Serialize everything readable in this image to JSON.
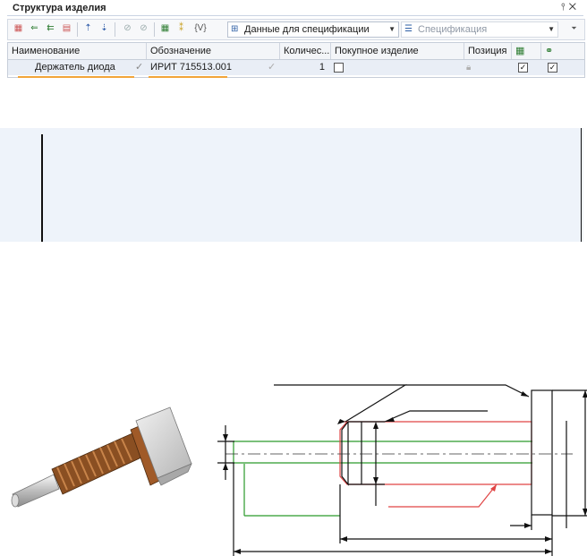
{
  "panel": {
    "title": "Структура изделия",
    "pin_icon": "pin-icon",
    "close_icon": "close-icon",
    "toolbar": {
      "spec_data_combo": "Данные для спецификации",
      "spec_combo": "Спецификация",
      "variables_label": "{V}"
    },
    "columns": [
      "Наименование",
      "Обозначение",
      "Количес...",
      "Покупное изделие",
      "Позиция"
    ],
    "rows": [
      {
        "name": "Держатель диода",
        "designation": "ИРИТ 715513.001",
        "quantity": "1",
        "purchased": false,
        "position_locked": true,
        "col6_checked": true,
        "col7_checked": true
      }
    ]
  },
  "colors": {
    "highlight_underline": "#f2a53a",
    "drawing_green": "#2a9a2a",
    "drawing_red": "#e04545",
    "panel_blue": "#eef3fa"
  }
}
